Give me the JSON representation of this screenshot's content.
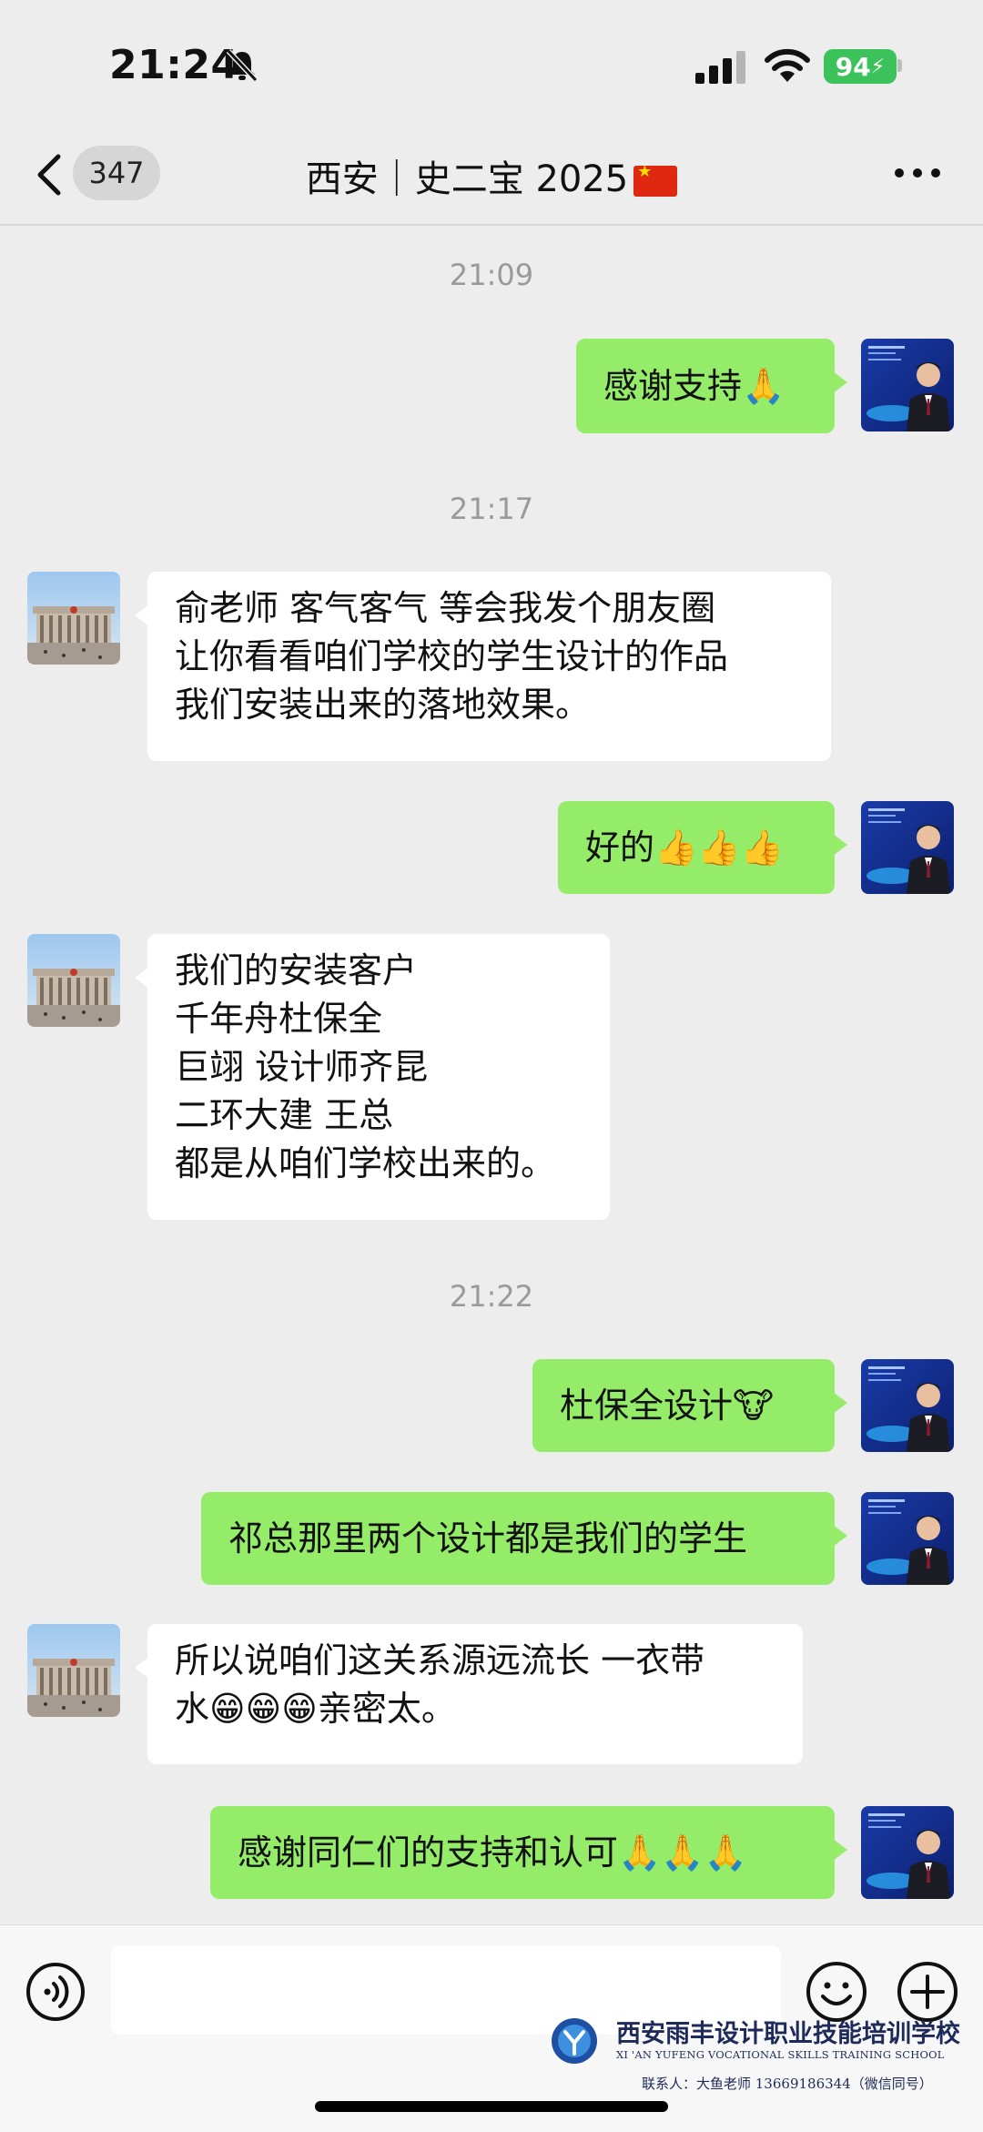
{
  "status_bar": {
    "time": "21:24",
    "battery": "94"
  },
  "header": {
    "unread_count": "347",
    "title": "西安｜史二宝 2025"
  },
  "messages": [
    {
      "type": "time",
      "text": "21:09"
    },
    {
      "type": "sent",
      "text": "感谢支持🙏"
    },
    {
      "type": "time",
      "text": "21:17"
    },
    {
      "type": "received",
      "text": "俞老师  客气客气 等会我发个朋友圈\n让你看看咱们学校的学生设计的作品\n我们安装出来的落地效果。"
    },
    {
      "type": "sent",
      "text": "好的👍👍👍"
    },
    {
      "type": "received",
      "text": "我们的安装客户\n千年舟杜保全\n巨翊  设计师齐昆\n二环大建  王总\n都是从咱们学校出来的。"
    },
    {
      "type": "time",
      "text": "21:22"
    },
    {
      "type": "sent",
      "text": "杜保全设计🐮"
    },
    {
      "type": "sent",
      "text": "祁总那里两个设计都是我们的学生"
    },
    {
      "type": "received",
      "text": "所以说咱们这关系源远流长  一衣带\n水😁😁😁亲密太。"
    },
    {
      "type": "sent",
      "text": "感谢同仁们的支持和认可🙏🙏🙏"
    }
  ],
  "watermark": {
    "name_cn": "西安雨丰设计职业技能培训学校",
    "name_en": "XI 'AN YUFENG VOCATIONAL SKILLS TRAINING SCHOOL",
    "contact": "联系人：大鱼老师 13669186344（微信同号）"
  },
  "colors": {
    "sent_bubble": "#95ec69",
    "received_bubble": "#ffffff",
    "background": "#ededed",
    "battery": "#3cc25a"
  },
  "icons": [
    "bell-off-icon",
    "signal-icon",
    "wifi-icon",
    "back-chevron-icon",
    "more-icon",
    "voice-icon",
    "emoji-icon",
    "plus-icon"
  ]
}
